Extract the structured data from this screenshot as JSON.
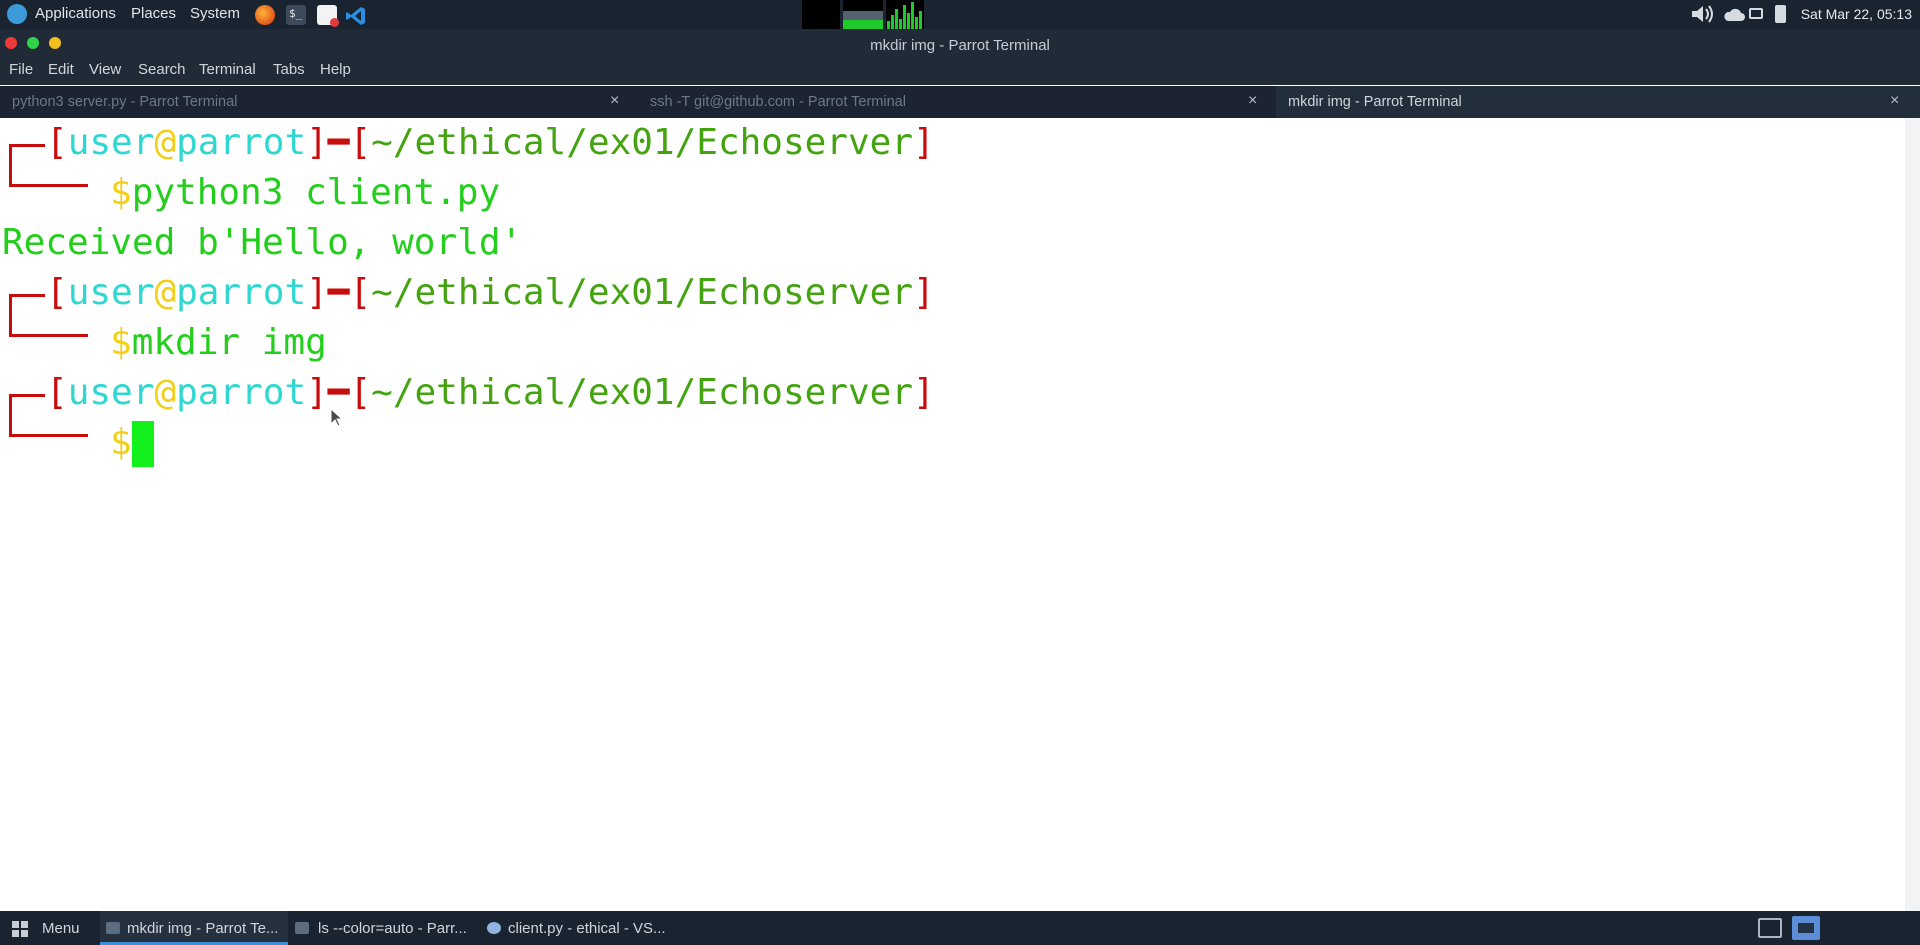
{
  "top_panel": {
    "menus": [
      "Applications",
      "Places",
      "System"
    ],
    "clock": "Sat Mar 22, 05:13"
  },
  "window": {
    "title": "mkdir img - Parrot Terminal"
  },
  "menubar": [
    "File",
    "Edit",
    "View",
    "Search",
    "Terminal",
    "Tabs",
    "Help"
  ],
  "tabs": [
    {
      "label": "python3 server.py - Parrot Terminal",
      "active": false
    },
    {
      "label": "ssh -T git@github.com - Parrot Terminal",
      "active": false
    },
    {
      "label": "mkdir img - Parrot Terminal",
      "active": true
    }
  ],
  "tab_close_glyph": "×",
  "terminal": {
    "prompt": {
      "user": "user",
      "at": "@",
      "host": "parrot",
      "path": "~/ethical/ex01/Echoserver",
      "symbol": "$"
    },
    "commands": [
      "python3 client.py",
      "mkdir img"
    ],
    "output": "Received b'Hello, world'"
  },
  "taskbar": {
    "menu_label": "Menu",
    "tasks": [
      {
        "label": "mkdir img - Parrot Te..."
      },
      {
        "label": "ls --color=auto - Parr..."
      },
      {
        "label": "client.py - ethical - VS..."
      }
    ]
  },
  "colors": {
    "panel_bg": "#1a2431",
    "prompt_red": "#c80c0c",
    "text_green": "#24ce1d",
    "host_cyan": "#2ed8d1",
    "symbol_yellow": "#f2cf14",
    "path_green": "#43a40f"
  }
}
